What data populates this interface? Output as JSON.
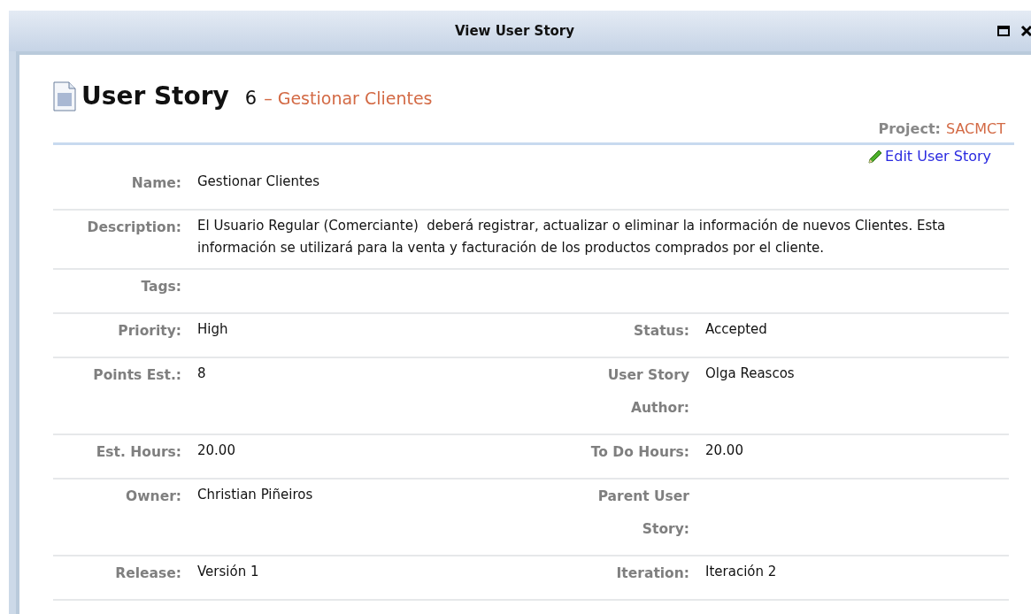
{
  "window": {
    "title": "View User Story"
  },
  "header": {
    "type": "User Story",
    "number": "6",
    "separator": "–",
    "name": "Gestionar Clientes",
    "project_label": "Project:",
    "project": "SACMCT",
    "edit_link": "Edit User Story"
  },
  "rows": [
    {
      "kind": "single",
      "label": "Name:",
      "value": "Gestionar Clientes"
    },
    {
      "kind": "single",
      "label": "Description:",
      "value": "El Usuario Regular (Comerciante)  deberá registrar, actualizar o eliminar la información de nuevos Clientes. Esta información se utilizará para la venta y facturación de los productos comprados por el cliente."
    },
    {
      "kind": "single",
      "label": "Tags:"
    },
    {
      "kind": "pair",
      "fields": [
        {
          "label": "Priority:",
          "value": "High"
        },
        {
          "label": "Status:",
          "value": "Accepted"
        }
      ]
    },
    {
      "kind": "pair",
      "fields": [
        {
          "label": "Points Est.:",
          "value": "8"
        },
        {
          "label": "User Story Author:",
          "value": "Olga Reascos"
        }
      ]
    },
    {
      "kind": "pair",
      "fields": [
        {
          "label": "Est. Hours:",
          "value": "20.00"
        },
        {
          "label": "To Do Hours:",
          "value": "20.00"
        }
      ]
    },
    {
      "kind": "pair",
      "fields": [
        {
          "label": "Owner:",
          "value": "Christian Piñeiros"
        },
        {
          "label": "Parent User Story:"
        }
      ]
    },
    {
      "kind": "pair",
      "fields": [
        {
          "label": "Release:",
          "value": "Versión 1"
        },
        {
          "label": "Iteration:",
          "value": "Iteración 2"
        }
      ]
    }
  ]
}
